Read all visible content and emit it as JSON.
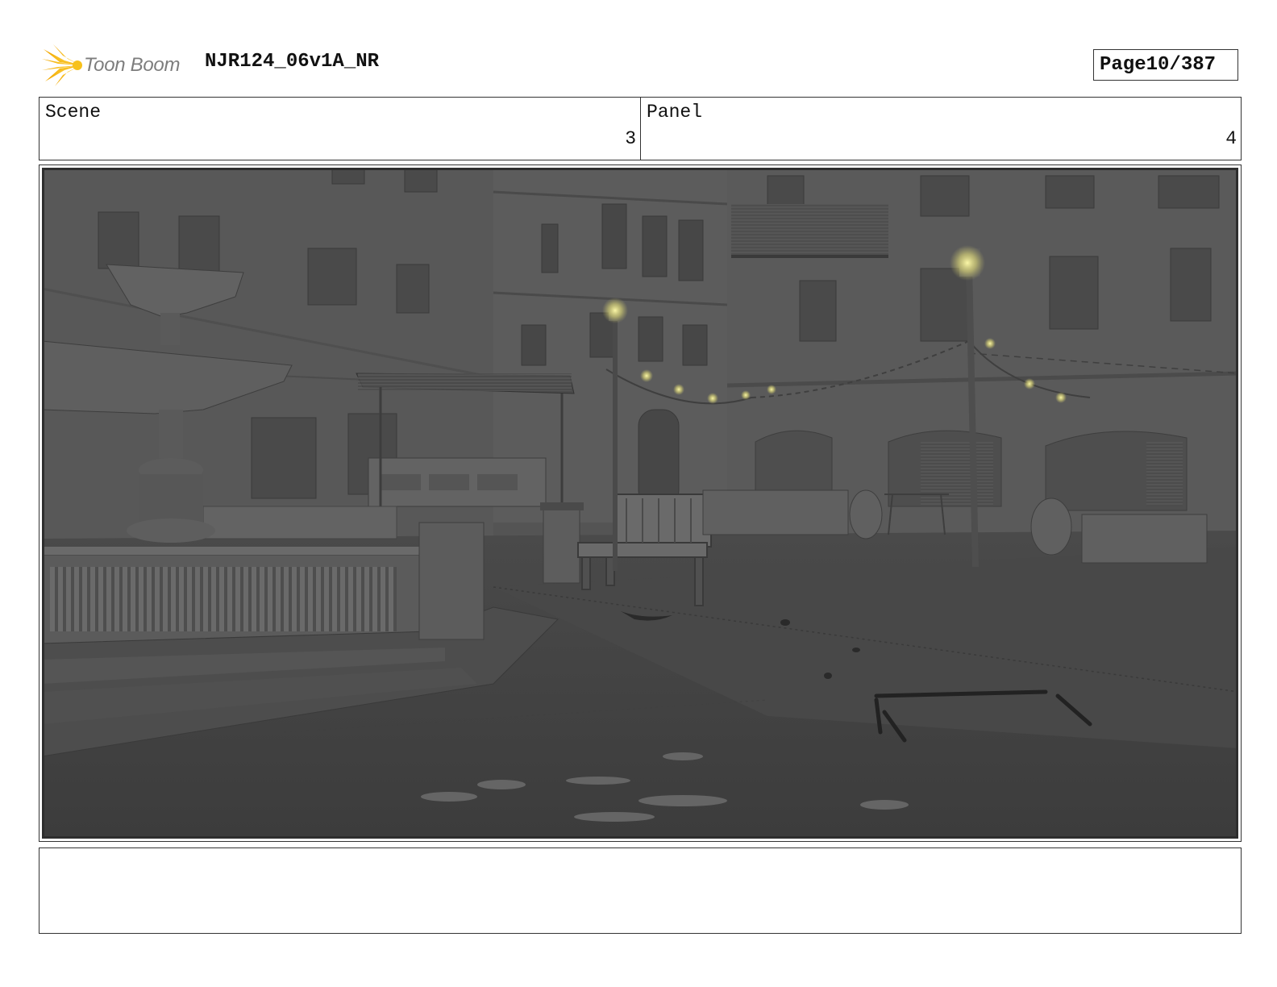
{
  "header": {
    "logo_text": "Toon Boom",
    "logo_icon": "starburst-icon",
    "doc_title": "NJR124_06v1A_NR",
    "page_label": "Page",
    "page_value": "10/387"
  },
  "info": {
    "scene_label": "Scene",
    "scene_value": "3",
    "panel_label": "Panel",
    "panel_value": "4"
  },
  "colors": {
    "logo_accent": "#f5b800",
    "lamp_glow": "#f3ef8a",
    "scene_gray": "#555555"
  }
}
